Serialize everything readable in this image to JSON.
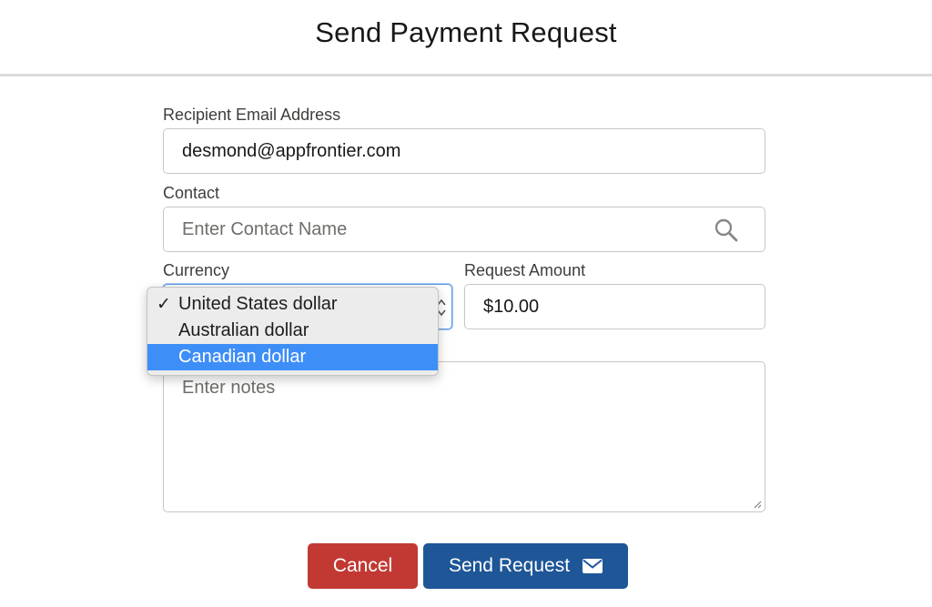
{
  "header": {
    "title": "Send Payment Request"
  },
  "form": {
    "email": {
      "label": "Recipient Email Address",
      "value": "desmond@appfrontier.com"
    },
    "contact": {
      "label": "Contact",
      "placeholder": "Enter Contact Name",
      "icon": "search-icon"
    },
    "currency": {
      "label": "Currency",
      "selected": "United States dollar",
      "options": [
        {
          "label": "United States dollar",
          "checked": true
        },
        {
          "label": "Australian dollar",
          "checked": false
        },
        {
          "label": "Canadian dollar",
          "checked": false,
          "highlighted": true
        }
      ],
      "check_mark": "✓"
    },
    "amount": {
      "label": "Request Amount",
      "value": "$10.00"
    },
    "notes": {
      "placeholder": "Enter notes"
    }
  },
  "actions": {
    "cancel_label": "Cancel",
    "send_label": "Send Request",
    "send_icon": "mail-icon"
  },
  "colors": {
    "cancel": "#c23934",
    "send": "#1e5697",
    "highlight": "#3d8ef7",
    "focus": "#5b9be6"
  }
}
